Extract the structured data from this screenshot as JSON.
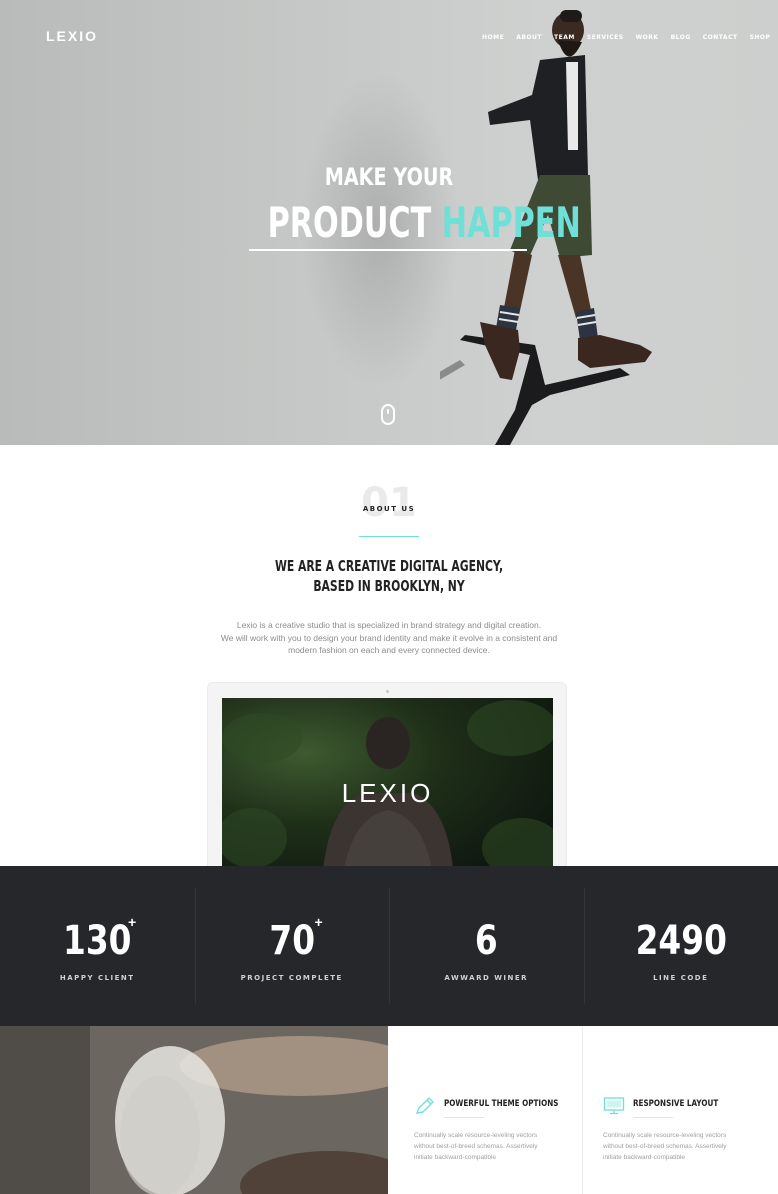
{
  "header": {
    "logo": "LEXIO",
    "nav": [
      "HOME",
      "ABOUT",
      "TEAM",
      "SERVICES",
      "WORK",
      "BLOG",
      "CONTACT",
      "SHOP"
    ]
  },
  "hero": {
    "line1": "MAKE YOUR",
    "line2_word1": "PRODUCT",
    "line2_word2": "HAPPEN"
  },
  "about": {
    "number": "01",
    "label": "ABOUT US",
    "heading_line1": "WE ARE A CREATIVE DIGITAL AGENCY,",
    "heading_line2": "BASED IN BROOKLYN, NY",
    "text_line1": "Lexio is a creative studio that is specialized in brand strategy and digital creation.",
    "text_line2": "We will work with you to design your brand identity and make it evolve in a consistent and",
    "text_line3": "modern fashion on each and every connected device."
  },
  "device": {
    "screen_logo": "LEXIO"
  },
  "stats": [
    {
      "value": "130",
      "plus": "+",
      "label": "HAPPY CLIENT"
    },
    {
      "value": "70",
      "plus": "+",
      "label": "PROJECT COMPLETE"
    },
    {
      "value": "6",
      "plus": "",
      "label": "AWWARD WINER"
    },
    {
      "value": "2490",
      "plus": "",
      "label": "LINE CODE"
    }
  ],
  "features": [
    {
      "icon": "pencil-icon",
      "title": "POWERFUL THEME OPTIONS",
      "text_line1": "Continually scale resource-leveling vectors",
      "text_line2": "without best-of-breed schemas. Assertively",
      "text_line3": "initiate backward-compatible"
    },
    {
      "icon": "monitor-icon",
      "title": "RESPONSIVE LAYOUT",
      "text_line1": "Continually scale resource-leveling vectors",
      "text_line2": "without best-of-breed schemas. Assertively",
      "text_line3": "initiate backward-compatible"
    }
  ],
  "colors": {
    "accent": "#6ee0d8",
    "dark": "#26272a"
  }
}
